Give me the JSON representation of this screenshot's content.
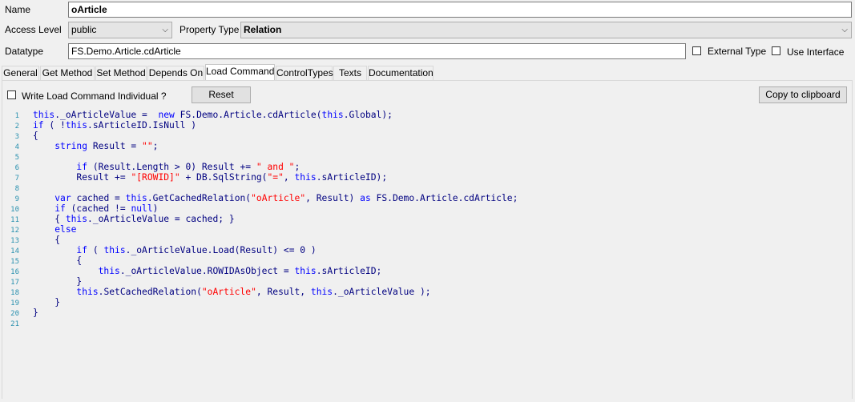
{
  "form": {
    "name_label": "Name",
    "name_value": "oArticle",
    "access_label": "Access Level",
    "access_value": "public",
    "property_type_label": "Property Type",
    "property_type_value": "Relation",
    "datatype_label": "Datatype",
    "datatype_value": "FS.Demo.Article.cdArticle",
    "external_type_label": "External Type",
    "use_interface_label": "Use Interface"
  },
  "tabs": [
    {
      "label": "General"
    },
    {
      "label": "Get Method"
    },
    {
      "label": "Set Method"
    },
    {
      "label": "Depends On"
    },
    {
      "label": "Load Command",
      "active": true
    },
    {
      "label": "ControlTypes"
    },
    {
      "label": "Texts"
    },
    {
      "label": "Documentation"
    }
  ],
  "toolbar": {
    "write_individual_label": "Write Load Command Individual ?",
    "reset_label": "Reset",
    "copy_label": "Copy to clipboard"
  },
  "code": {
    "lines": [
      {
        "n": "1",
        "t": [
          [
            "kw",
            "this"
          ],
          [
            "bl",
            "._oArticleValue =  "
          ],
          [
            "kw",
            "new "
          ],
          [
            "bl",
            "FS.Demo.Article.cdArticle("
          ],
          [
            "kw",
            "this"
          ],
          [
            "bl",
            ".Global);"
          ]
        ]
      },
      {
        "n": "2",
        "t": [
          [
            "kw",
            "if "
          ],
          [
            "bl",
            "( !"
          ],
          [
            "kw",
            "this"
          ],
          [
            "bl",
            ".sArticleID.IsNull )"
          ]
        ]
      },
      {
        "n": "3",
        "t": [
          [
            "bl",
            "{"
          ]
        ]
      },
      {
        "n": "4",
        "t": [
          [
            "bl",
            "    "
          ],
          [
            "kw",
            "string "
          ],
          [
            "bl",
            "Result = "
          ],
          [
            "st",
            "\"\""
          ],
          [
            "bl",
            ";"
          ]
        ]
      },
      {
        "n": "5",
        "t": []
      },
      {
        "n": "6",
        "t": [
          [
            "bl",
            "        "
          ],
          [
            "kw",
            "if "
          ],
          [
            "bl",
            "(Result.Length > 0) Result += "
          ],
          [
            "st",
            "\" and \""
          ],
          [
            "bl",
            ";"
          ]
        ]
      },
      {
        "n": "7",
        "t": [
          [
            "bl",
            "        Result += "
          ],
          [
            "st",
            "\"[ROWID]\""
          ],
          [
            "bl",
            " + DB.SqlString("
          ],
          [
            "st",
            "\"=\""
          ],
          [
            "bl",
            ", "
          ],
          [
            "kw",
            "this"
          ],
          [
            "bl",
            ".sArticleID);"
          ]
        ]
      },
      {
        "n": "8",
        "t": []
      },
      {
        "n": "9",
        "t": [
          [
            "bl",
            "    "
          ],
          [
            "kw",
            "var "
          ],
          [
            "bl",
            "cached = "
          ],
          [
            "kw",
            "this"
          ],
          [
            "bl",
            ".GetCachedRelation("
          ],
          [
            "st",
            "\"oArticle\""
          ],
          [
            "bl",
            ", Result) "
          ],
          [
            "kw",
            "as "
          ],
          [
            "bl",
            "FS.Demo.Article.cdArticle;"
          ]
        ]
      },
      {
        "n": "10",
        "t": [
          [
            "bl",
            "    "
          ],
          [
            "kw",
            "if "
          ],
          [
            "bl",
            "(cached != "
          ],
          [
            "kw",
            "null"
          ],
          [
            "bl",
            ")"
          ]
        ]
      },
      {
        "n": "11",
        "t": [
          [
            "bl",
            "    { "
          ],
          [
            "kw",
            "this"
          ],
          [
            "bl",
            "._oArticleValue = cached; }"
          ]
        ]
      },
      {
        "n": "12",
        "t": [
          [
            "bl",
            "    "
          ],
          [
            "kw",
            "else"
          ]
        ]
      },
      {
        "n": "13",
        "t": [
          [
            "bl",
            "    {"
          ]
        ]
      },
      {
        "n": "14",
        "t": [
          [
            "bl",
            "        "
          ],
          [
            "kw",
            "if "
          ],
          [
            "bl",
            "( "
          ],
          [
            "kw",
            "this"
          ],
          [
            "bl",
            "._oArticleValue.Load(Result) <= 0 )"
          ]
        ]
      },
      {
        "n": "15",
        "t": [
          [
            "bl",
            "        {"
          ]
        ]
      },
      {
        "n": "16",
        "t": [
          [
            "bl",
            "            "
          ],
          [
            "kw",
            "this"
          ],
          [
            "bl",
            "._oArticleValue.ROWIDAsObject = "
          ],
          [
            "kw",
            "this"
          ],
          [
            "bl",
            ".sArticleID;"
          ]
        ]
      },
      {
        "n": "17",
        "t": [
          [
            "bl",
            "        }"
          ]
        ]
      },
      {
        "n": "18",
        "t": [
          [
            "bl",
            "        "
          ],
          [
            "kw",
            "this"
          ],
          [
            "bl",
            ".SetCachedRelation("
          ],
          [
            "st",
            "\"oArticle\""
          ],
          [
            "bl",
            ", Result, "
          ],
          [
            "kw",
            "this"
          ],
          [
            "bl",
            "._oArticleValue );"
          ]
        ]
      },
      {
        "n": "19",
        "t": [
          [
            "bl",
            "    }"
          ]
        ]
      },
      {
        "n": "20",
        "t": [
          [
            "bl",
            "}"
          ]
        ]
      },
      {
        "n": "21",
        "t": []
      }
    ]
  },
  "colors": {
    "keyword": "#0000ff",
    "string": "#ff0000",
    "identifier": "#000080",
    "line_number": "#2b91af"
  }
}
